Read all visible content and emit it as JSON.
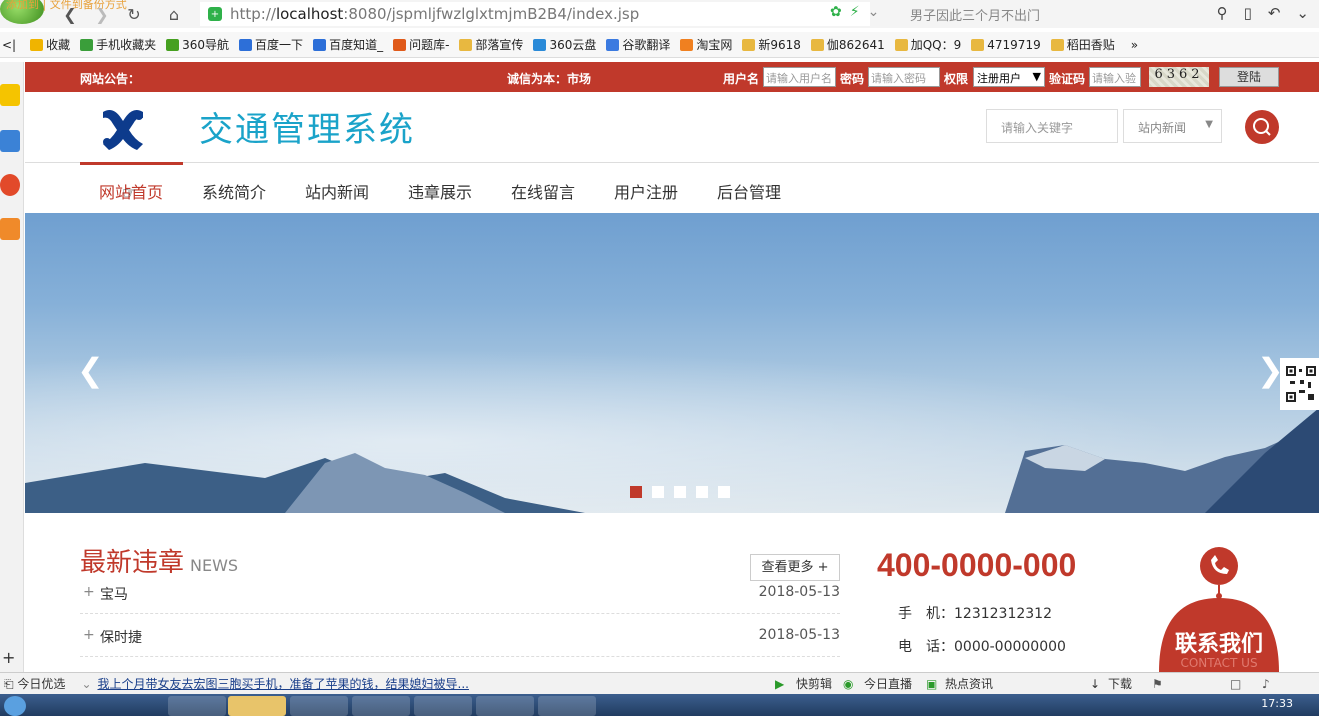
{
  "browser": {
    "promo_text": "添加到 | 文件到备份方式",
    "url_host": "http://",
    "url_domain": "localhost",
    "url_path": ":8080/jspmljfwzlglxtmjmB2B4/index.jsp",
    "search_suggest": "男子因此三个月不出门"
  },
  "bookmarks": [
    {
      "label": "收藏",
      "color": "#f0b400"
    },
    {
      "label": "手机收藏夹",
      "color": "#3a9e3a"
    },
    {
      "label": "360导航",
      "color": "#46a020"
    },
    {
      "label": "百度一下",
      "color": "#2d6fd8"
    },
    {
      "label": "百度知道_",
      "color": "#2d6fd8"
    },
    {
      "label": "问题库-",
      "color": "#e05a1a"
    },
    {
      "label": "部落宣传",
      "color": "#e8b840"
    },
    {
      "label": "360云盘",
      "color": "#2a8ad8"
    },
    {
      "label": "谷歌翻译",
      "color": "#3b7ae0"
    },
    {
      "label": "淘宝网",
      "color": "#f08020"
    },
    {
      "label": "新9618",
      "color": "#e8b840"
    },
    {
      "label": "伽862641",
      "color": "#e8b840"
    },
    {
      "label": "加QQ：9",
      "color": "#e8b840"
    },
    {
      "label": "4719719",
      "color": "#e8b840"
    },
    {
      "label": "稻田香贴",
      "color": "#e8b840"
    }
  ],
  "topbar": {
    "notice_label": "网站公告：",
    "slogan": "诚信为本：市场",
    "username_label": "用户名",
    "username_placeholder": "请输入用户名",
    "password_label": "密码",
    "password_placeholder": "请输入密码",
    "role_label": "权限",
    "role_value": "注册用户",
    "captcha_label": "验证码",
    "captcha_placeholder": "请输入验",
    "captcha_text": "6362",
    "login_label": "登陆"
  },
  "header": {
    "site_title": "交通管理系统",
    "keyword_placeholder": "请输入关键字",
    "scope_value": "站内新闻"
  },
  "nav": [
    "网站首页",
    "系统简介",
    "站内新闻",
    "违章展示",
    "在线留言",
    "用户注册",
    "后台管理"
  ],
  "banner": {
    "dot_count": 5,
    "active_dot": 0
  },
  "news": {
    "title": "最新违章",
    "title_en": "NEWS",
    "more_label": "查看更多 +",
    "items": [
      {
        "title": "宝马",
        "date": "2018-05-13"
      },
      {
        "title": "保时捷",
        "date": "2018-05-13"
      }
    ]
  },
  "contact": {
    "hotline": "400-0000-000",
    "mobile_label": "手　机：",
    "mobile": "12312312312",
    "phone_label": "电　话：",
    "phone": "0000-00000000",
    "badge_cn": "联系我们",
    "badge_en": "CONTACT US"
  },
  "statusbar": {
    "left": "今日优选",
    "headline": "我上个月带女友去宏图三胞买手机，准备了苹果的钱，结果媳妇被导...",
    "items": [
      "快剪辑",
      "今日直播",
      "热点资讯",
      "下载"
    ]
  },
  "taskbar": {
    "clock": "17:33"
  },
  "colors": {
    "accent": "#c0392b",
    "title_blue": "#1aa3c9"
  }
}
